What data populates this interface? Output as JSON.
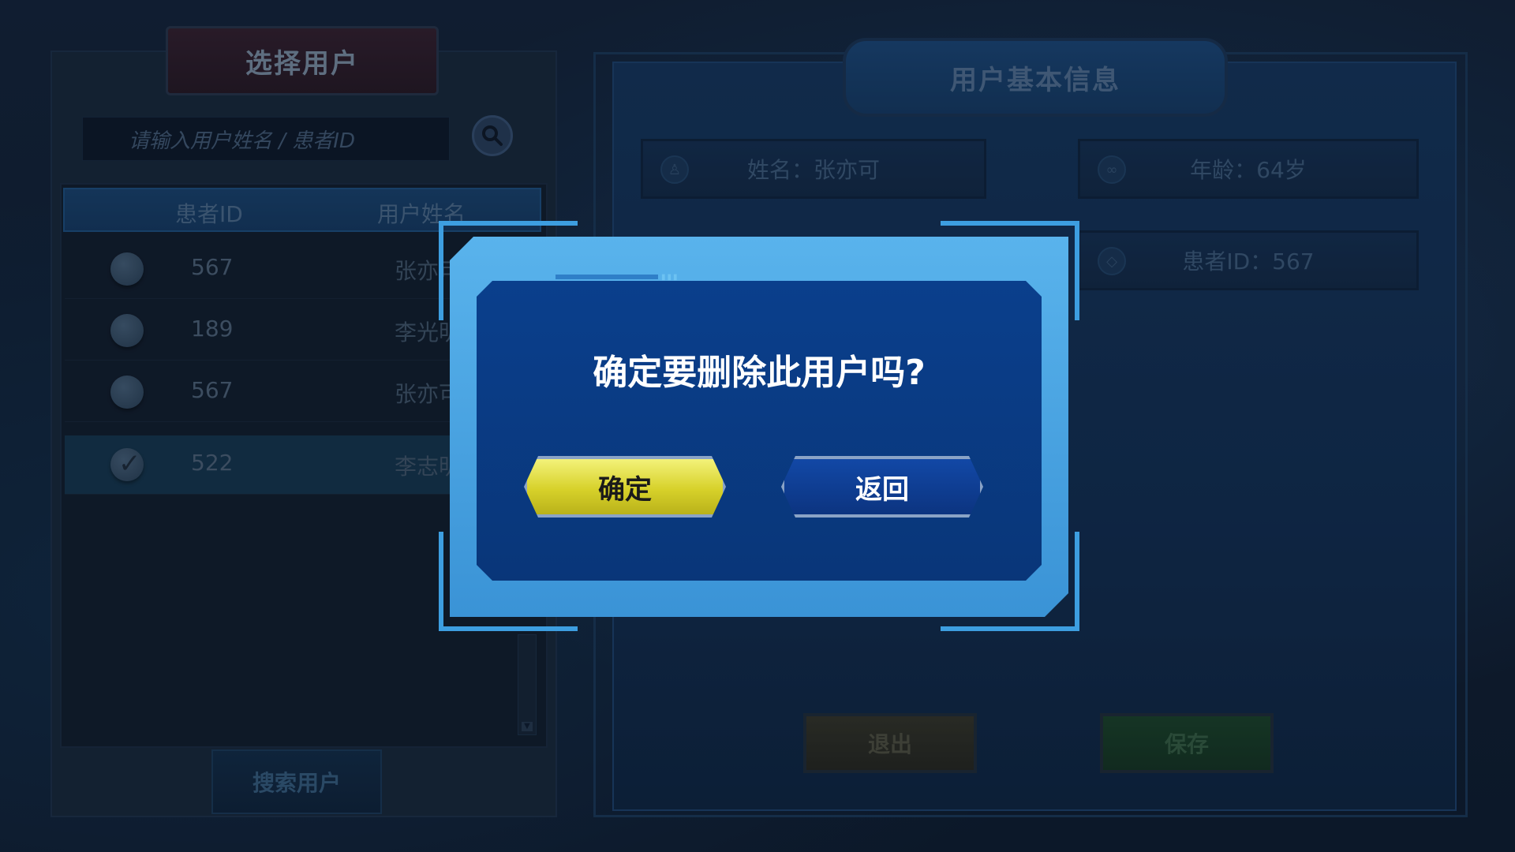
{
  "left_panel": {
    "title": "选择用户",
    "search_placeholder": "请输入用户姓名 / 患者ID",
    "columns": [
      "患者ID",
      "用户姓名"
    ],
    "rows": [
      {
        "id": "567",
        "name": "张亦可",
        "selected": false
      },
      {
        "id": "189",
        "name": "李光明",
        "selected": false
      },
      {
        "id": "567",
        "name": "张亦可",
        "selected": false
      },
      {
        "id": "522",
        "name": "李志明",
        "selected": true
      }
    ],
    "search_user_button": "搜索用户"
  },
  "right_panel": {
    "title": "用户基本信息",
    "name_field": "姓名：张亦可",
    "age_field": "年龄：64岁",
    "patient_id_field": "患者ID：567",
    "exit_button": "退出",
    "save_button": "保存"
  },
  "dialog": {
    "message": "确定要删除此用户吗?",
    "confirm_button": "确定",
    "back_button": "返回"
  },
  "colors": {
    "accent_yellow": "#e6e23a",
    "dialog_blue": "#0a3f8c",
    "frame_blue": "#59b3ec"
  }
}
